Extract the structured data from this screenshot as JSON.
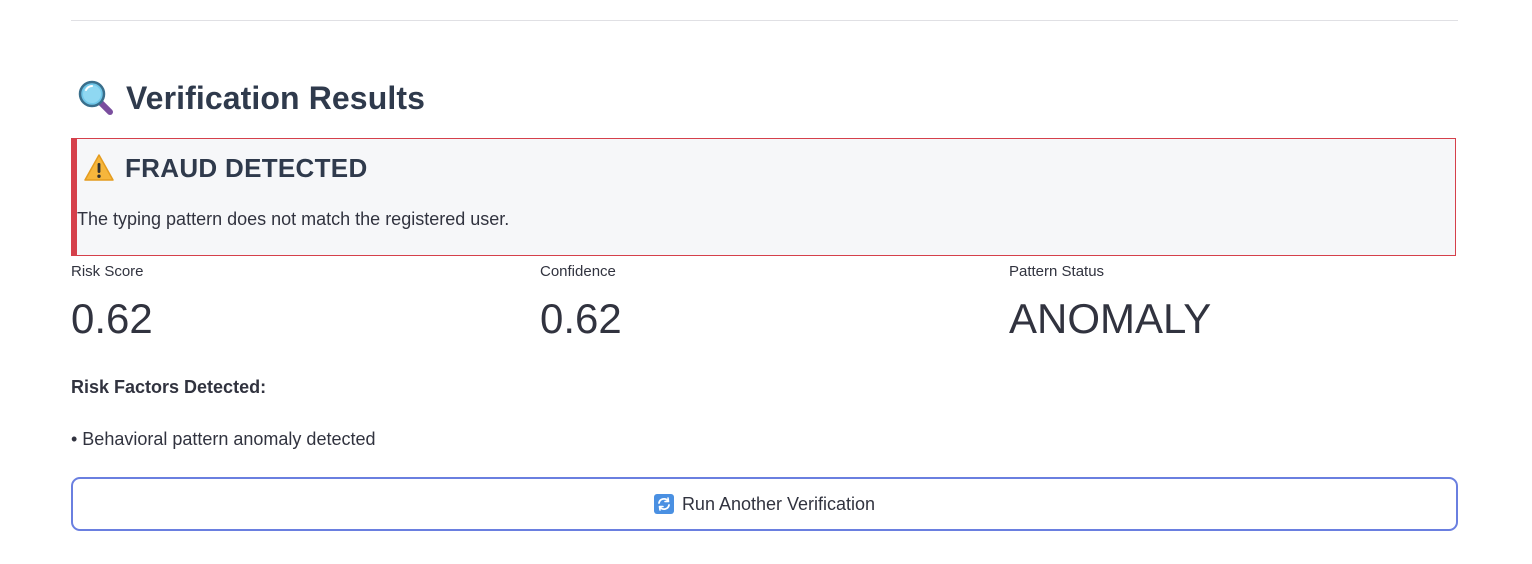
{
  "header": {
    "icon": "magnifying-glass-icon",
    "title": "Verification Results"
  },
  "alert": {
    "icon": "warning-icon",
    "title": "FRAUD DETECTED",
    "message": "The typing pattern does not match the registered user.",
    "accent_color": "#d5404b"
  },
  "metrics": [
    {
      "label": "Risk Score",
      "value": "0.62"
    },
    {
      "label": "Confidence",
      "value": "0.62"
    },
    {
      "label": "Pattern Status",
      "value": "ANOMALY"
    }
  ],
  "risk_factors": {
    "title": "Risk Factors Detected:",
    "items": [
      "• Behavioral pattern anomaly detected"
    ]
  },
  "actions": {
    "run_again_icon": "refresh-icon",
    "run_again_label": "Run Another Verification",
    "button_border_color": "#6a7fe0"
  }
}
